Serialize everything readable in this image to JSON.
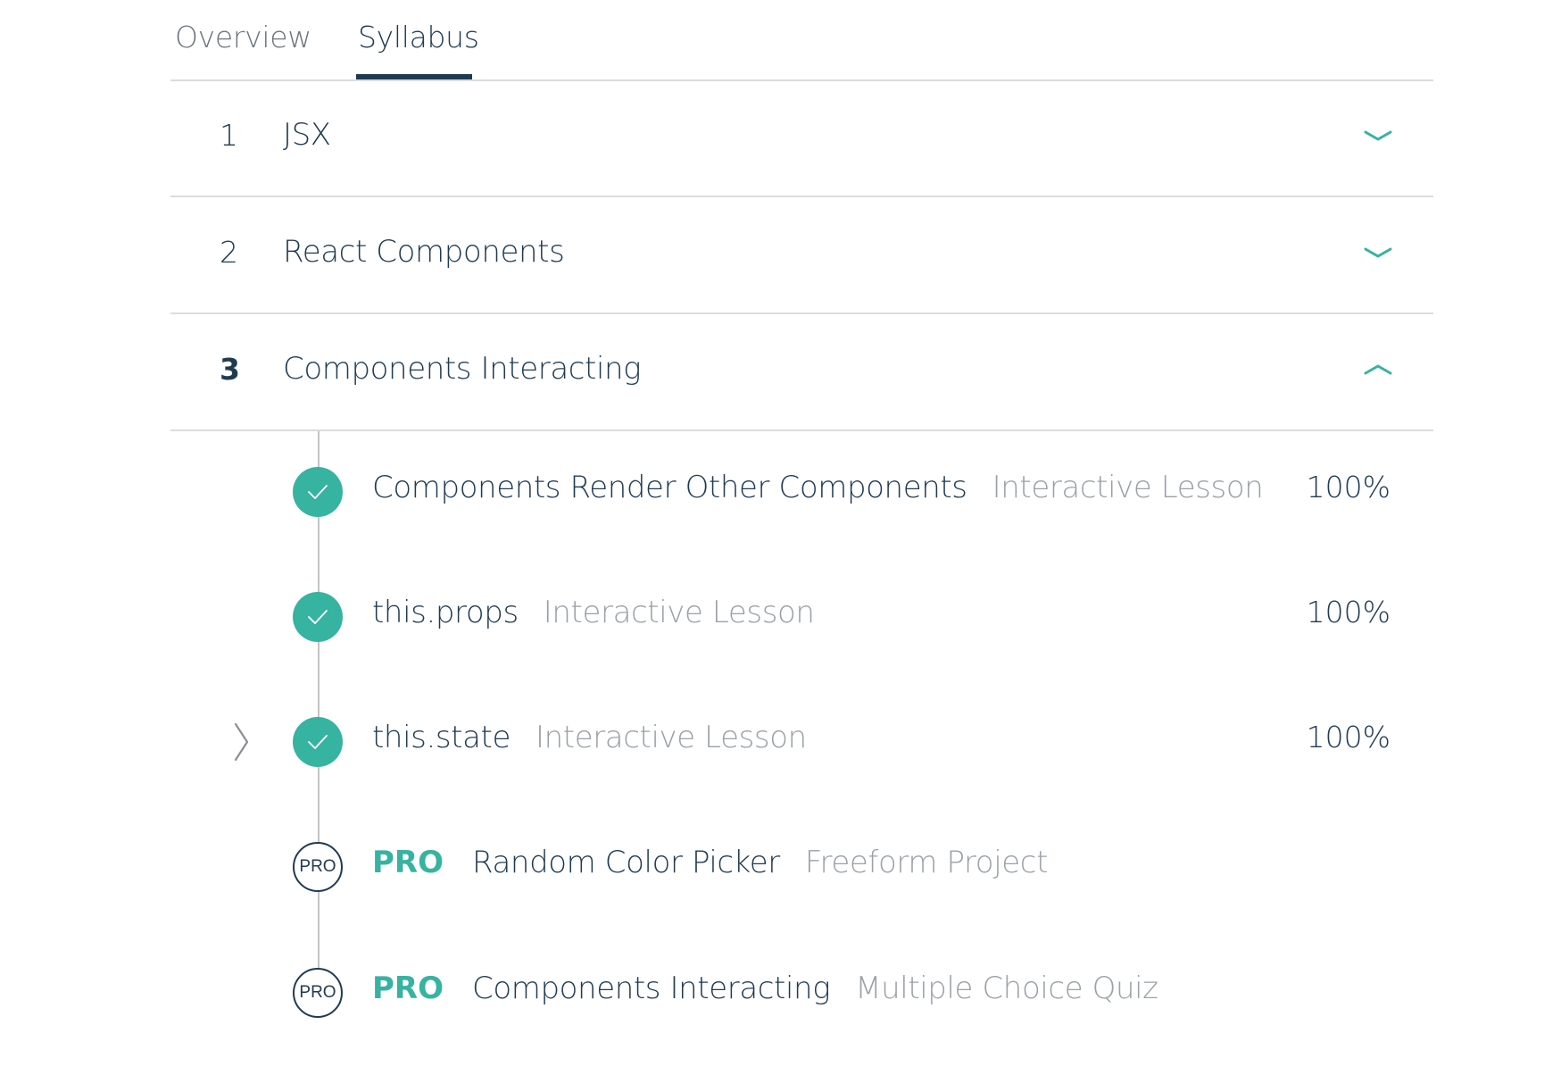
{
  "tabs": {
    "overview": "Overview",
    "syllabus": "Syllabus",
    "active": "syllabus"
  },
  "modules": [
    {
      "number": "1",
      "title": "JSX",
      "expanded": false
    },
    {
      "number": "2",
      "title": "React Components",
      "expanded": false
    },
    {
      "number": "3",
      "title": "Components Interacting",
      "expanded": true
    }
  ],
  "lessons": [
    {
      "title": "Components Render Other Components",
      "type": "Interactive Lesson",
      "progress": "100%",
      "status": "complete"
    },
    {
      "title": "this.props",
      "type": "Interactive Lesson",
      "progress": "100%",
      "status": "complete"
    },
    {
      "title": "this.state",
      "type": "Interactive Lesson",
      "progress": "100%",
      "status": "complete",
      "current": true
    },
    {
      "pro_label": "PRO",
      "badge": "PRO",
      "title": "Random Color Picker",
      "type": "Freeform Project",
      "status": "pro"
    },
    {
      "pro_label": "PRO",
      "badge": "PRO",
      "title": "Components Interacting",
      "type": "Multiple Choice Quiz",
      "status": "pro"
    }
  ],
  "colors": {
    "accent": "#36b3a1",
    "navy": "#1f3b54",
    "muted": "#9aa1a7",
    "divider": "#dcdcdc"
  },
  "icons": {
    "collapsed": "chevron-down-icon",
    "expanded": "chevron-up-icon",
    "complete": "checkmark-icon",
    "current": "chevron-right-icon"
  }
}
